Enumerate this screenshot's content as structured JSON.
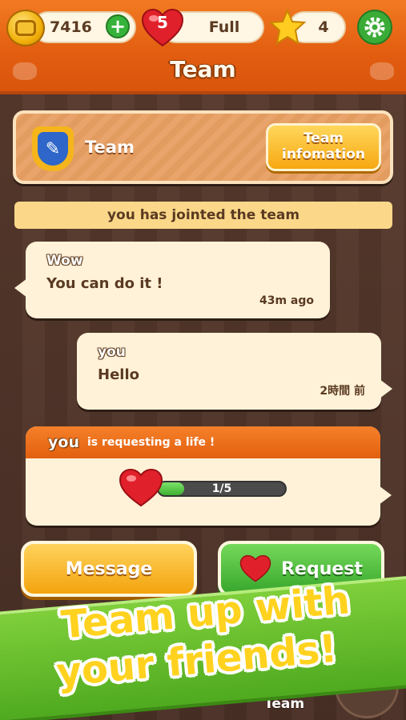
{
  "topbar": {
    "coins": "7416",
    "lives_count": "5",
    "lives_status": "Full",
    "stars": "4",
    "title": "Team"
  },
  "team": {
    "name": "Team",
    "info_button": "Team\ninfomation"
  },
  "notice": "you has jointed the team",
  "messages": [
    {
      "sender": "Wow",
      "text": "You can do it !",
      "time": "43m ago"
    },
    {
      "sender": "you",
      "text": "Hello",
      "time": "2時間 前"
    }
  ],
  "life_request": {
    "user": "you",
    "text": "is requesting a life !",
    "progress_label": "1/5",
    "progress": 0.2
  },
  "buttons": {
    "message": "Message",
    "request": "Request"
  },
  "promo": {
    "line1": "Team up with",
    "line2": "your friends!"
  },
  "bottom_nav": {
    "active_label": "Team"
  },
  "colors": {
    "header": "#e25d10",
    "accent_green": "#37a62c",
    "accent_yellow": "#f3a30d"
  }
}
